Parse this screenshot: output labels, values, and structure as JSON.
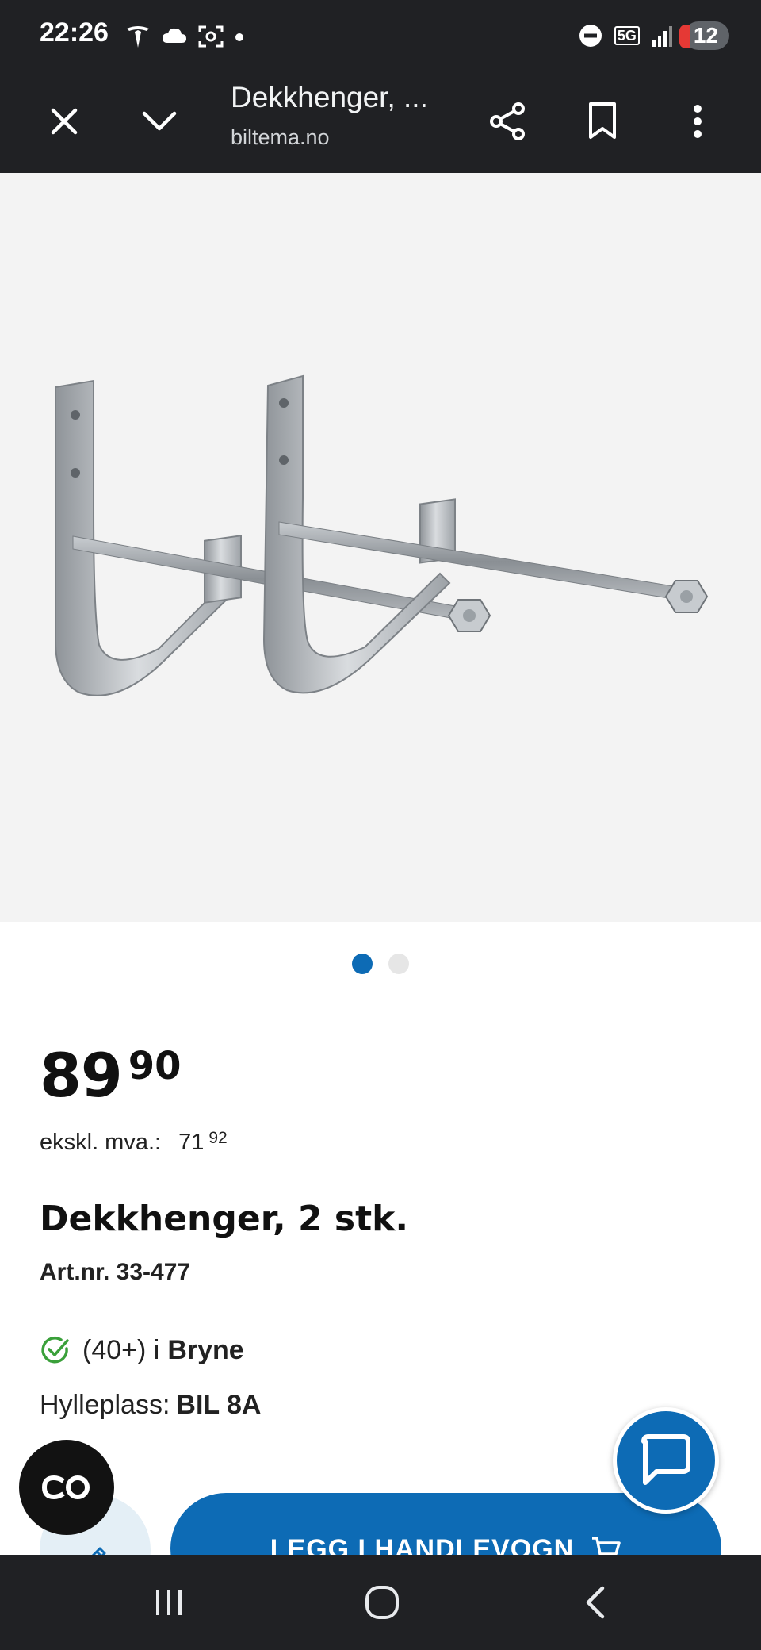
{
  "status_bar": {
    "time": "22:26",
    "network": "5G",
    "notification_count": "12"
  },
  "toolbar": {
    "title": "Dekkhenger, ...",
    "domain": "biltema.no",
    "icons": [
      "close-icon",
      "chevron-down-icon",
      "share-icon",
      "bookmark-icon",
      "more-vert-icon"
    ]
  },
  "gallery": {
    "image_count": 2,
    "active_index": 0
  },
  "product": {
    "price_int": "89",
    "price_dec": "90",
    "excl_label": "ekskl. mva.:",
    "excl_int": "71",
    "excl_dec": "92",
    "title": "Dekkhenger, 2 stk.",
    "art_nr": "Art.nr. 33-477",
    "stock_count": "(40+) i",
    "stock_store": "Bryne",
    "shelf_label": "Hylleplass:",
    "shelf_value": "BIL 8A"
  },
  "actions": {
    "cart_label": "LEGG I HANDLEVOGN"
  },
  "colors": {
    "brand_blue": "#0d6bb5",
    "stock_green": "#3aa03a",
    "system_bar": "#202124"
  }
}
